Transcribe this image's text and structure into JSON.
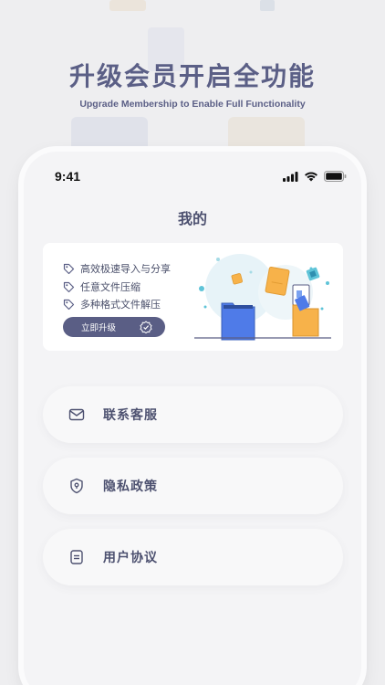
{
  "promo": {
    "title": "升级会员开启全功能",
    "subtitle": "Upgrade Membership to Enable Full Functionality"
  },
  "status_bar": {
    "time": "9:41",
    "icons": [
      "signal-icon",
      "wifi-icon",
      "battery-icon"
    ]
  },
  "page": {
    "title": "我的"
  },
  "vip_card": {
    "features": [
      "高效极速导入与分享",
      "任意文件压缩",
      "多种格式文件解压"
    ],
    "button_label": "立即升级"
  },
  "menu": [
    {
      "label": "联系客服",
      "icon": "mail-icon"
    },
    {
      "label": "隐私政策",
      "icon": "shield-icon"
    },
    {
      "label": "用户协议",
      "icon": "document-icon"
    }
  ],
  "colors": {
    "accent": "#5a5e85",
    "folder_blue": "#4f7be8",
    "folder_orange": "#f7b24a",
    "background": "#eeeef0"
  }
}
